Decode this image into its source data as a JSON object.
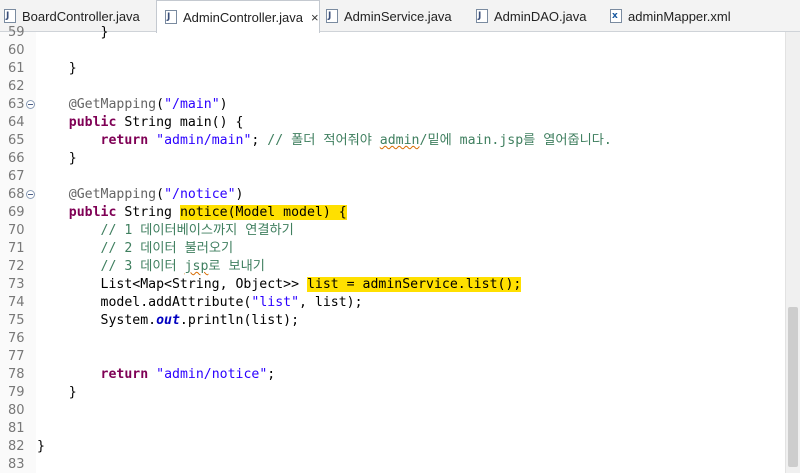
{
  "tabs": [
    {
      "label": "BoardController.java",
      "icon": "java-file-icon",
      "active": false
    },
    {
      "label": "AdminController.java",
      "icon": "java-file-icon",
      "active": true
    },
    {
      "label": "AdminService.java",
      "icon": "java-file-icon",
      "active": false
    },
    {
      "label": "AdminDAO.java",
      "icon": "java-file-icon",
      "active": false
    },
    {
      "label": "adminMapper.xml",
      "icon": "xml-file-icon",
      "active": false
    }
  ],
  "close_glyph": "×",
  "lines": [
    {
      "no": "59",
      "fold": false,
      "parts": [
        {
          "t": "        }",
          "c": ""
        }
      ]
    },
    {
      "no": "60",
      "fold": false,
      "parts": []
    },
    {
      "no": "61",
      "fold": false,
      "parts": [
        {
          "t": "    }",
          "c": ""
        }
      ]
    },
    {
      "no": "62",
      "fold": false,
      "parts": []
    },
    {
      "no": "63",
      "fold": true,
      "parts": [
        {
          "t": "    ",
          "c": ""
        },
        {
          "t": "@GetMapping",
          "c": "ann"
        },
        {
          "t": "(",
          "c": ""
        },
        {
          "t": "\"/main\"",
          "c": "str"
        },
        {
          "t": ")",
          "c": ""
        }
      ]
    },
    {
      "no": "64",
      "fold": false,
      "parts": [
        {
          "t": "    ",
          "c": ""
        },
        {
          "t": "public",
          "c": "kw"
        },
        {
          "t": " String main() {",
          "c": ""
        }
      ]
    },
    {
      "no": "65",
      "fold": false,
      "parts": [
        {
          "t": "        ",
          "c": ""
        },
        {
          "t": "return",
          "c": "kw"
        },
        {
          "t": " ",
          "c": ""
        },
        {
          "t": "\"admin/main\"",
          "c": "str"
        },
        {
          "t": "; ",
          "c": ""
        },
        {
          "t": "// 폴더 적어줘야 ",
          "c": "cm"
        },
        {
          "t": "admin",
          "c": "cm squig"
        },
        {
          "t": "/밑에 main.jsp를 열어줍니다.",
          "c": "cm"
        }
      ]
    },
    {
      "no": "66",
      "fold": false,
      "parts": [
        {
          "t": "    }",
          "c": ""
        }
      ]
    },
    {
      "no": "67",
      "fold": false,
      "parts": []
    },
    {
      "no": "68",
      "fold": true,
      "parts": [
        {
          "t": "    ",
          "c": ""
        },
        {
          "t": "@GetMapping",
          "c": "ann"
        },
        {
          "t": "(",
          "c": ""
        },
        {
          "t": "\"/notice\"",
          "c": "str"
        },
        {
          "t": ")",
          "c": ""
        }
      ]
    },
    {
      "no": "69",
      "fold": false,
      "parts": [
        {
          "t": "    ",
          "c": ""
        },
        {
          "t": "public",
          "c": "kw"
        },
        {
          "t": " String ",
          "c": ""
        },
        {
          "t": "notice(Model model) {",
          "c": "hl"
        }
      ]
    },
    {
      "no": "70",
      "fold": false,
      "parts": [
        {
          "t": "        ",
          "c": ""
        },
        {
          "t": "// 1 데이터베이스까지 연결하기",
          "c": "cm"
        }
      ]
    },
    {
      "no": "71",
      "fold": false,
      "parts": [
        {
          "t": "        ",
          "c": ""
        },
        {
          "t": "// 2 데이터 불러오기",
          "c": "cm"
        }
      ]
    },
    {
      "no": "72",
      "fold": false,
      "parts": [
        {
          "t": "        ",
          "c": ""
        },
        {
          "t": "// 3 데이터 ",
          "c": "cm"
        },
        {
          "t": "jsp",
          "c": "cm squig"
        },
        {
          "t": "로 보내기",
          "c": "cm"
        }
      ]
    },
    {
      "no": "73",
      "fold": false,
      "parts": [
        {
          "t": "        List<Map<String, Object>> ",
          "c": ""
        },
        {
          "t": "list = adminService.list();",
          "c": "hl"
        }
      ]
    },
    {
      "no": "74",
      "fold": false,
      "parts": [
        {
          "t": "        model.addAttribute(",
          "c": ""
        },
        {
          "t": "\"list\"",
          "c": "str"
        },
        {
          "t": ", list);",
          "c": ""
        }
      ]
    },
    {
      "no": "75",
      "fold": false,
      "parts": [
        {
          "t": "        System.",
          "c": ""
        },
        {
          "t": "out",
          "c": "st"
        },
        {
          "t": ".println(list);",
          "c": ""
        }
      ]
    },
    {
      "no": "76",
      "fold": false,
      "parts": []
    },
    {
      "no": "77",
      "fold": false,
      "parts": []
    },
    {
      "no": "78",
      "fold": false,
      "parts": [
        {
          "t": "        ",
          "c": ""
        },
        {
          "t": "return",
          "c": "kw"
        },
        {
          "t": " ",
          "c": ""
        },
        {
          "t": "\"admin/notice\"",
          "c": "str"
        },
        {
          "t": ";",
          "c": ""
        }
      ]
    },
    {
      "no": "79",
      "fold": false,
      "parts": [
        {
          "t": "    }",
          "c": ""
        }
      ]
    },
    {
      "no": "80",
      "fold": false,
      "parts": []
    },
    {
      "no": "81",
      "fold": false,
      "parts": []
    },
    {
      "no": "82",
      "fold": false,
      "parts": [
        {
          "t": "}",
          "c": ""
        }
      ]
    },
    {
      "no": "83",
      "fold": false,
      "parts": []
    }
  ]
}
